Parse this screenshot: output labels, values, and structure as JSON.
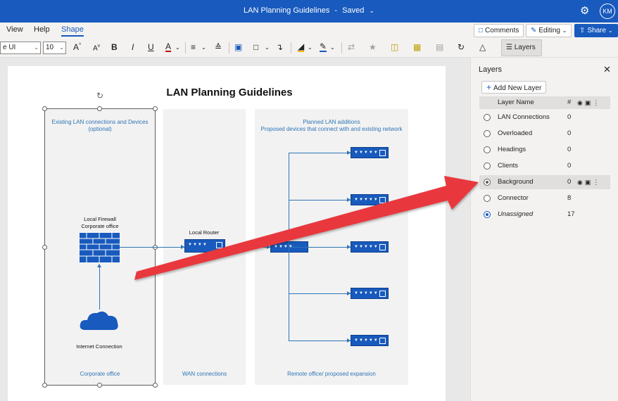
{
  "app": {
    "doc_title": "LAN Planning Guidelines",
    "save_status": "Saved",
    "avatar_initials": "KM"
  },
  "menu": {
    "tabs": [
      "View",
      "Help",
      "Shape"
    ],
    "active_tab": "Shape",
    "comments_label": "Comments",
    "editing_label": "Editing",
    "share_label": "Share"
  },
  "toolbar": {
    "font_name": "e UI",
    "font_size": "10",
    "grow_font": "A",
    "shrink_font": "A",
    "bold": "B",
    "italic": "I",
    "underline": "U",
    "font_color": "A",
    "layers_label": "Layers"
  },
  "diagram": {
    "title": "LAN Planning Guidelines",
    "zones": {
      "corporate_top": "Existing LAN connections and Devices (optional)",
      "corporate_bottom": "Corporate office",
      "wan_bottom": "WAN connections",
      "remote_top_1": "Planned LAN additions",
      "remote_top_2": "Proposed devices that connect with and existing network",
      "remote_bottom": "Remote office/ proposed expansion"
    },
    "devices": {
      "firewall_1": "Local Firewall",
      "firewall_2": "Corporate office",
      "router": "Local Router",
      "internet": "Internet Connection"
    }
  },
  "layers_pane": {
    "title": "Layers",
    "add_label": "Add New Layer",
    "header_name": "Layer Name",
    "header_count": "#",
    "rows": [
      {
        "name": "LAN Connections",
        "count": "0"
      },
      {
        "name": "Overloaded",
        "count": "0"
      },
      {
        "name": "Headings",
        "count": "0"
      },
      {
        "name": "Clients",
        "count": "0"
      },
      {
        "name": "Background",
        "count": "0"
      },
      {
        "name": "Connector",
        "count": "8"
      },
      {
        "name": "Unassigned",
        "count": "17"
      }
    ]
  },
  "colors": {
    "accent": "#185abd",
    "diagram_blue": "#2e75b6",
    "annotation_arrow": "#e8383d"
  }
}
